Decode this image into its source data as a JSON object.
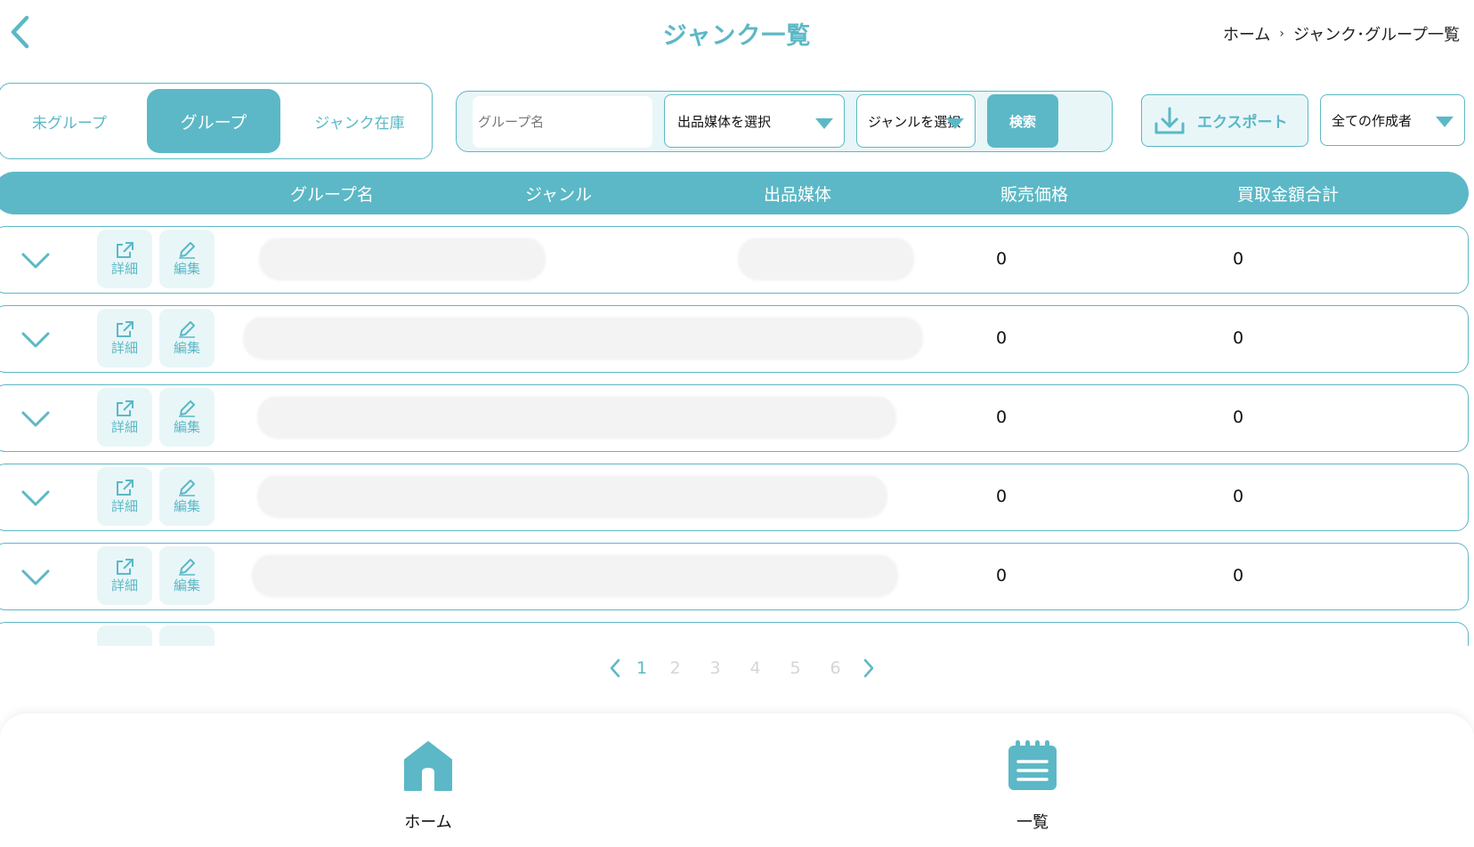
{
  "header": {
    "title": "ジャンク一覧",
    "breadcrumb": [
      "ホーム",
      "ジャンク･グループ一覧"
    ],
    "breadcrumb_separator": "›"
  },
  "tabs": [
    {
      "label": "未グループ",
      "active": false
    },
    {
      "label": "グループ",
      "active": true
    },
    {
      "label": "ジャンク在庫",
      "active": false
    }
  ],
  "search": {
    "group_name_placeholder": "グループ名",
    "media_select": "出品媒体を選択",
    "genre_select": "ジャンルを選択",
    "search_button": "検索"
  },
  "export": {
    "label": "エクスポート"
  },
  "creator_select": {
    "label": "全ての作成者"
  },
  "table": {
    "columns": [
      "グループ名",
      "ジャンル",
      "出品媒体",
      "販売価格",
      "買取金額合計"
    ],
    "action_labels": {
      "detail": "詳細",
      "edit": "編集"
    },
    "rows": [
      {
        "price": "0",
        "total": "0"
      },
      {
        "price": "0",
        "total": "0"
      },
      {
        "price": "0",
        "total": "0"
      },
      {
        "price": "0",
        "total": "0"
      },
      {
        "price": "0",
        "total": "0"
      }
    ]
  },
  "pagination": {
    "pages": [
      "1",
      "2",
      "3",
      "4",
      "5",
      "6"
    ],
    "current": "1"
  },
  "bottom_nav": {
    "home": "ホーム",
    "list": "一覧"
  },
  "colors": {
    "accent": "#5cb8c6",
    "accent_light": "#e8f6f8",
    "inactive_page": "#d5d5d5"
  }
}
